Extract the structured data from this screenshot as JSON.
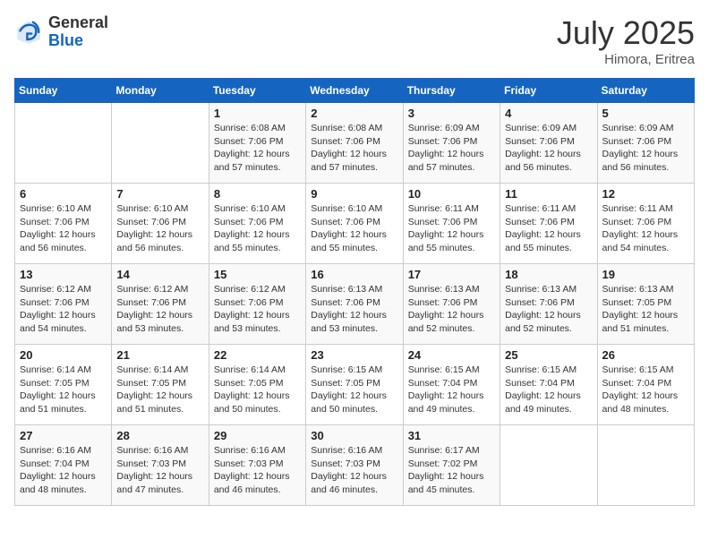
{
  "header": {
    "logo_general": "General",
    "logo_blue": "Blue",
    "month_year": "July 2025",
    "location": "Himora, Eritrea"
  },
  "days_of_week": [
    "Sunday",
    "Monday",
    "Tuesday",
    "Wednesday",
    "Thursday",
    "Friday",
    "Saturday"
  ],
  "weeks": [
    [
      null,
      null,
      {
        "day": 1,
        "sunrise": "6:08 AM",
        "sunset": "7:06 PM",
        "daylight": "12 hours and 57 minutes."
      },
      {
        "day": 2,
        "sunrise": "6:08 AM",
        "sunset": "7:06 PM",
        "daylight": "12 hours and 57 minutes."
      },
      {
        "day": 3,
        "sunrise": "6:09 AM",
        "sunset": "7:06 PM",
        "daylight": "12 hours and 57 minutes."
      },
      {
        "day": 4,
        "sunrise": "6:09 AM",
        "sunset": "7:06 PM",
        "daylight": "12 hours and 56 minutes."
      },
      {
        "day": 5,
        "sunrise": "6:09 AM",
        "sunset": "7:06 PM",
        "daylight": "12 hours and 56 minutes."
      }
    ],
    [
      {
        "day": 6,
        "sunrise": "6:10 AM",
        "sunset": "7:06 PM",
        "daylight": "12 hours and 56 minutes."
      },
      {
        "day": 7,
        "sunrise": "6:10 AM",
        "sunset": "7:06 PM",
        "daylight": "12 hours and 56 minutes."
      },
      {
        "day": 8,
        "sunrise": "6:10 AM",
        "sunset": "7:06 PM",
        "daylight": "12 hours and 55 minutes."
      },
      {
        "day": 9,
        "sunrise": "6:10 AM",
        "sunset": "7:06 PM",
        "daylight": "12 hours and 55 minutes."
      },
      {
        "day": 10,
        "sunrise": "6:11 AM",
        "sunset": "7:06 PM",
        "daylight": "12 hours and 55 minutes."
      },
      {
        "day": 11,
        "sunrise": "6:11 AM",
        "sunset": "7:06 PM",
        "daylight": "12 hours and 55 minutes."
      },
      {
        "day": 12,
        "sunrise": "6:11 AM",
        "sunset": "7:06 PM",
        "daylight": "12 hours and 54 minutes."
      }
    ],
    [
      {
        "day": 13,
        "sunrise": "6:12 AM",
        "sunset": "7:06 PM",
        "daylight": "12 hours and 54 minutes."
      },
      {
        "day": 14,
        "sunrise": "6:12 AM",
        "sunset": "7:06 PM",
        "daylight": "12 hours and 53 minutes."
      },
      {
        "day": 15,
        "sunrise": "6:12 AM",
        "sunset": "7:06 PM",
        "daylight": "12 hours and 53 minutes."
      },
      {
        "day": 16,
        "sunrise": "6:13 AM",
        "sunset": "7:06 PM",
        "daylight": "12 hours and 53 minutes."
      },
      {
        "day": 17,
        "sunrise": "6:13 AM",
        "sunset": "7:06 PM",
        "daylight": "12 hours and 52 minutes."
      },
      {
        "day": 18,
        "sunrise": "6:13 AM",
        "sunset": "7:06 PM",
        "daylight": "12 hours and 52 minutes."
      },
      {
        "day": 19,
        "sunrise": "6:13 AM",
        "sunset": "7:05 PM",
        "daylight": "12 hours and 51 minutes."
      }
    ],
    [
      {
        "day": 20,
        "sunrise": "6:14 AM",
        "sunset": "7:05 PM",
        "daylight": "12 hours and 51 minutes."
      },
      {
        "day": 21,
        "sunrise": "6:14 AM",
        "sunset": "7:05 PM",
        "daylight": "12 hours and 51 minutes."
      },
      {
        "day": 22,
        "sunrise": "6:14 AM",
        "sunset": "7:05 PM",
        "daylight": "12 hours and 50 minutes."
      },
      {
        "day": 23,
        "sunrise": "6:15 AM",
        "sunset": "7:05 PM",
        "daylight": "12 hours and 50 minutes."
      },
      {
        "day": 24,
        "sunrise": "6:15 AM",
        "sunset": "7:04 PM",
        "daylight": "12 hours and 49 minutes."
      },
      {
        "day": 25,
        "sunrise": "6:15 AM",
        "sunset": "7:04 PM",
        "daylight": "12 hours and 49 minutes."
      },
      {
        "day": 26,
        "sunrise": "6:15 AM",
        "sunset": "7:04 PM",
        "daylight": "12 hours and 48 minutes."
      }
    ],
    [
      {
        "day": 27,
        "sunrise": "6:16 AM",
        "sunset": "7:04 PM",
        "daylight": "12 hours and 48 minutes."
      },
      {
        "day": 28,
        "sunrise": "6:16 AM",
        "sunset": "7:03 PM",
        "daylight": "12 hours and 47 minutes."
      },
      {
        "day": 29,
        "sunrise": "6:16 AM",
        "sunset": "7:03 PM",
        "daylight": "12 hours and 46 minutes."
      },
      {
        "day": 30,
        "sunrise": "6:16 AM",
        "sunset": "7:03 PM",
        "daylight": "12 hours and 46 minutes."
      },
      {
        "day": 31,
        "sunrise": "6:17 AM",
        "sunset": "7:02 PM",
        "daylight": "12 hours and 45 minutes."
      },
      null,
      null
    ]
  ]
}
